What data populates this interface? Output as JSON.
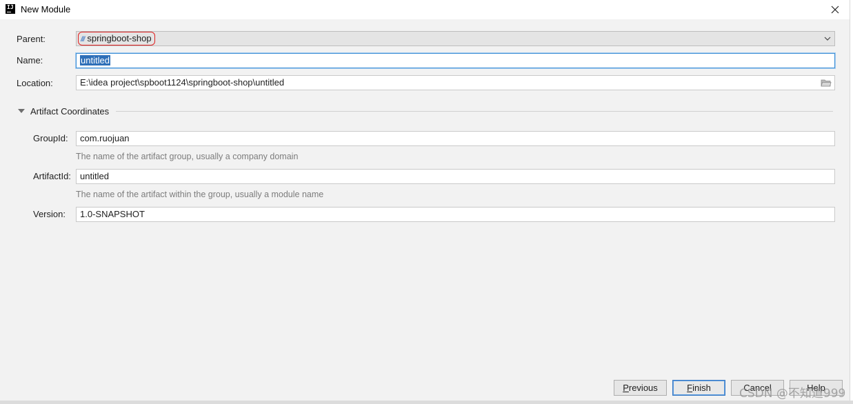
{
  "window": {
    "title": "New Module",
    "app_icon": "IJ",
    "close_icon": "close-icon"
  },
  "form": {
    "parent": {
      "label": "Parent:",
      "value": "springboot-shop",
      "module_icon": "///"
    },
    "name": {
      "label": "Name:",
      "value": "untitled"
    },
    "location": {
      "label": "Location:",
      "value": "E:\\idea project\\spboot1124\\springboot-shop\\untitled"
    }
  },
  "artifact": {
    "section_title": "Artifact Coordinates",
    "group_id": {
      "label": "GroupId:",
      "value": "com.ruojuan",
      "hint": "The name of the artifact group, usually a company domain"
    },
    "artifact_id": {
      "label": "ArtifactId:",
      "value": "untitled",
      "hint": "The name of the artifact within the group, usually a module name"
    },
    "version": {
      "label": "Version:",
      "value": "1.0-SNAPSHOT"
    }
  },
  "buttons": {
    "previous": {
      "mnemonic": "P",
      "rest": "revious"
    },
    "finish": {
      "mnemonic": "F",
      "rest": "inish"
    },
    "cancel": "Cancel",
    "help": "Help"
  },
  "watermark": "CSDN @不知道999",
  "colors": {
    "accent": "#3d8fd6",
    "selection": "#2e6fb8",
    "annotation": "#e02020"
  }
}
